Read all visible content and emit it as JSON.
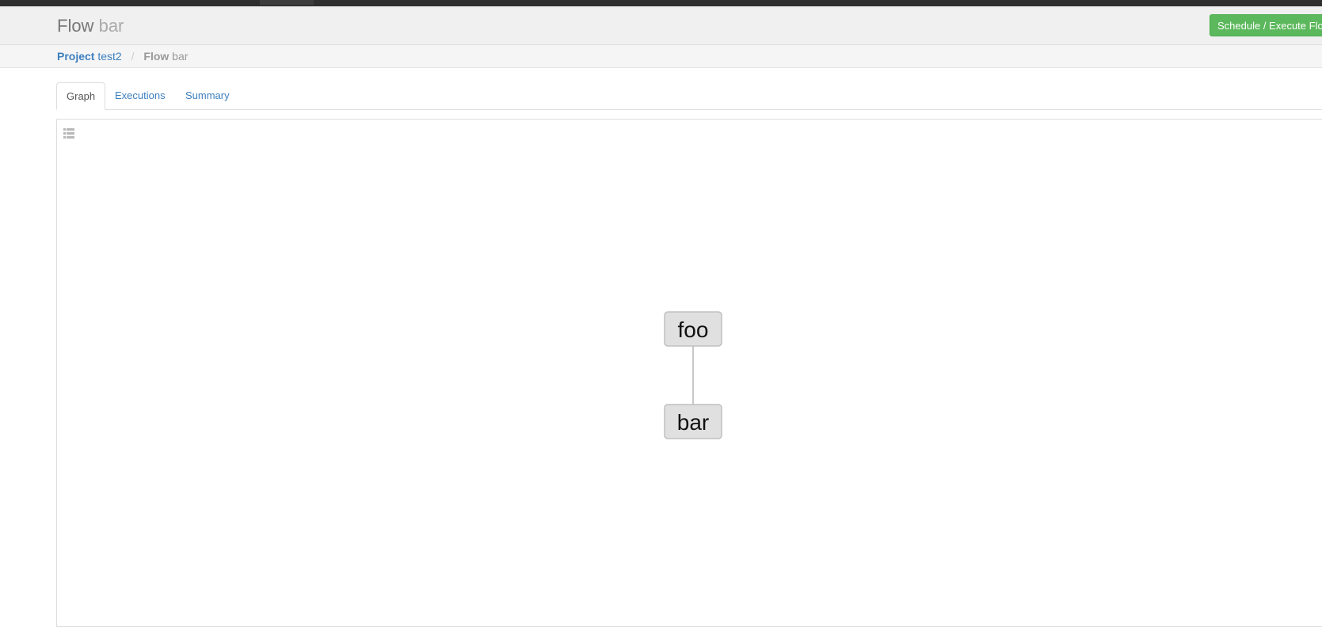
{
  "header": {
    "title_key": "Flow",
    "title_value": "bar",
    "schedule_button": "Schedule / Execute Flow"
  },
  "breadcrumb": {
    "project_key": "Project",
    "project_value": "test2",
    "separator": "/",
    "flow_key": "Flow",
    "flow_value": "bar"
  },
  "tabs": [
    {
      "label": "Graph",
      "active": true
    },
    {
      "label": "Executions",
      "active": false
    },
    {
      "label": "Summary",
      "active": false
    }
  ],
  "graph": {
    "toggle_icon": "list-icon",
    "nodes": [
      {
        "id": "foo",
        "label": "foo"
      },
      {
        "id": "bar",
        "label": "bar"
      }
    ],
    "edges": [
      {
        "from": "foo",
        "to": "bar"
      }
    ]
  },
  "colors": {
    "node_fill": "#e0e0e0",
    "node_stroke": "#bfbfbf",
    "edge": "#c8c8c8",
    "link": "#3c7fbf",
    "success_button": "#5cb85c"
  }
}
